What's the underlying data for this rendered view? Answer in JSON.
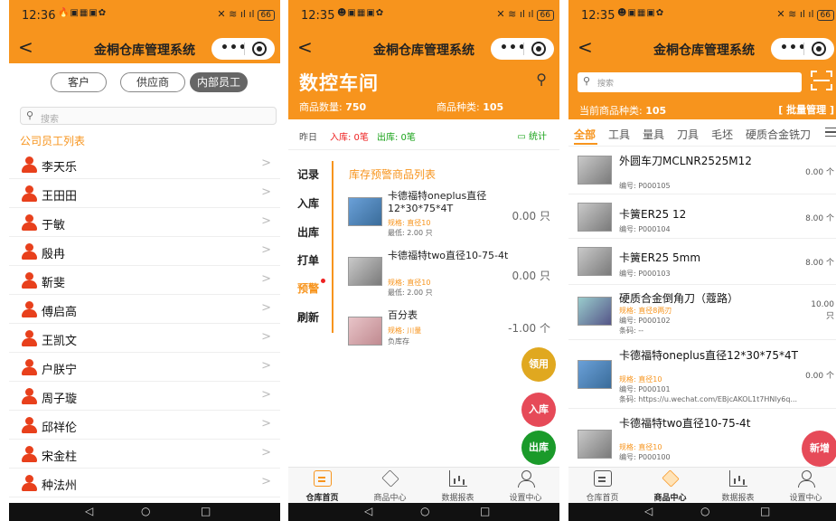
{
  "phones": [
    {
      "status": {
        "time": "12:36",
        "battery": "66"
      },
      "nav": {
        "title": "金桐仓库管理系统",
        "back": "<",
        "menu": "•••"
      },
      "segments": [
        {
          "label": "客户",
          "active": false
        },
        {
          "label": "供应商",
          "active": false
        },
        {
          "label": "内部员工",
          "active": true
        }
      ],
      "search_placeholder": "搜索",
      "list_title": "公司员工列表",
      "employees": [
        "李天乐",
        "王田田",
        "于敏",
        "殷冉",
        "靳斐",
        "傅启高",
        "王凯文",
        "户朕宁",
        "周子璇",
        "邱祥伦",
        "宋金柱",
        "种法州"
      ]
    },
    {
      "status": {
        "time": "12:35",
        "battery": "66"
      },
      "nav": {
        "title": "金桐仓库管理系统",
        "back": "<",
        "menu": "•••"
      },
      "header": {
        "title": "数控车间",
        "count_label": "商品数量:",
        "count_value": "750",
        "types_label": "商品种类:",
        "types_value": "105"
      },
      "day": {
        "label": "昨日",
        "in": "入库: 0笔",
        "out": "出库: 0笔",
        "stats": "统计"
      },
      "menu": [
        "记录",
        "入库",
        "出库",
        "打单",
        "预警",
        "刷新"
      ],
      "selected_menu": "预警",
      "warn_title": "库存预警商品列表",
      "warn_items": [
        {
          "name": "卡德福特oneplus直径12*30*75*4T",
          "spec": "规格: 直径10",
          "min": "最低: 2.00 只",
          "qty": "0.00 只"
        },
        {
          "name": "卡德福特two直径10-75-4t",
          "spec": "规格: 直径10",
          "min": "最低: 2.00 只",
          "qty": "0.00 只"
        },
        {
          "name": "百分表",
          "spec": "规格: 川量",
          "min": "负库存",
          "qty": "-1.00 个"
        }
      ],
      "fabs": {
        "use": "领用",
        "in": "入库",
        "out": "出库"
      },
      "tabs": [
        "仓库首页",
        "商品中心",
        "数据报表",
        "设置中心"
      ],
      "active_tab": 0
    },
    {
      "status": {
        "time": "12:35",
        "battery": "66"
      },
      "nav": {
        "title": "金桐仓库管理系统",
        "back": "<",
        "menu": "•••"
      },
      "search_placeholder": "搜索",
      "types_label": "当前商品种类:",
      "types_value": "105",
      "batch": "[ 批量管理 ]",
      "categories": [
        "全部",
        "工具",
        "量具",
        "刀具",
        "毛坯",
        "硬质合金铣刀"
      ],
      "products": [
        {
          "name": "外圆车刀MCLNR2525M12",
          "code": "编号: P000105",
          "qty": "0.00 个"
        },
        {
          "name": "卡簧ER25 12",
          "code": "编号: P000104",
          "qty": "8.00 个"
        },
        {
          "name": "卡簧ER25 5mm",
          "code": "编号: P000103",
          "qty": "8.00 个"
        },
        {
          "name": "硬质合金倒角刀（蔻路）",
          "spec": "规格: 直径8两刃",
          "code": "编号: P000102",
          "barcode": "条码: --",
          "qty": "10.00 只"
        },
        {
          "name": "卡德福特oneplus直径12*30*75*4T",
          "spec": "规格: 直径10",
          "code": "编号: P000101",
          "barcode": "条码: https://u.wechat.com/EBjcAKOL1t7HNly6q...",
          "qty": "0.00 个"
        },
        {
          "name": "卡德福特two直径10-75-4t",
          "spec": "规格: 直径10",
          "code": "编号: P000100",
          "qty": ""
        }
      ],
      "new_btn": "新增",
      "tabs": [
        "仓库首页",
        "商品中心",
        "数据报表",
        "设置中心"
      ],
      "active_tab": 1
    }
  ],
  "colors": {
    "accent": "#f7941d",
    "red": "#e64a58",
    "green": "#1a9a2a",
    "gold": "#e0a820"
  }
}
